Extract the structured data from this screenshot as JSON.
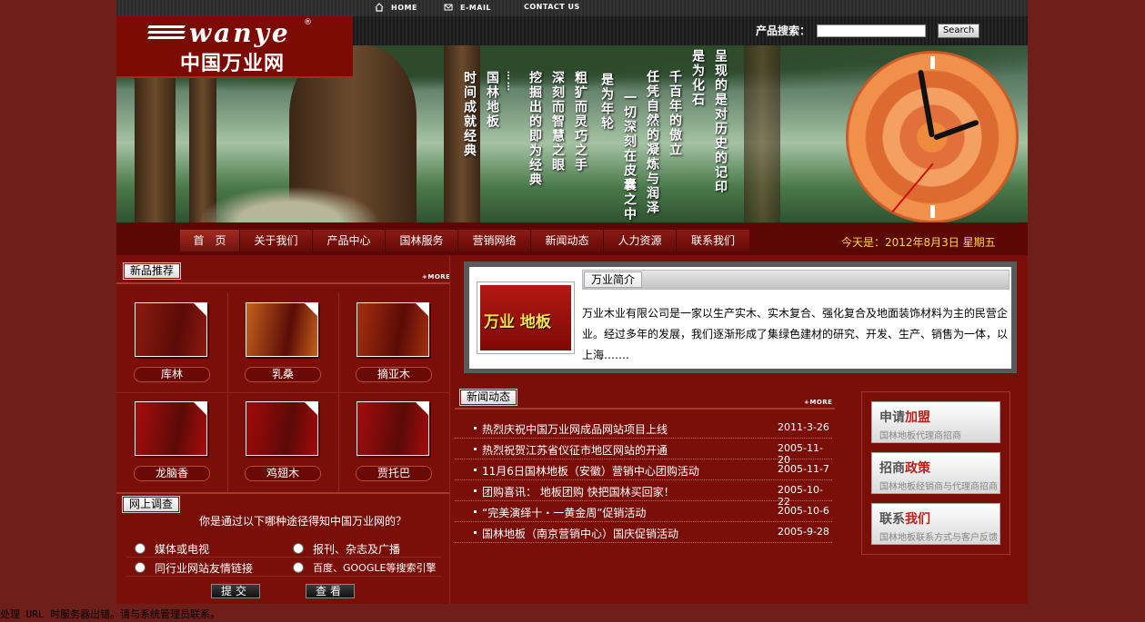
{
  "topbar": {
    "home": "HOME",
    "email": "E-MAIL",
    "contact": "CONTACT US"
  },
  "logo": {
    "en": "wanye",
    "reg": "®",
    "cn": "中国万业网"
  },
  "search": {
    "label": "产品搜索：",
    "value": "",
    "button": "Search"
  },
  "banner": {
    "columns": [
      "呈现的是对历史的记印",
      "是为化石",
      "千百年的傲立",
      "任凭自然的凝炼与润泽",
      "一切深刻在皮囊之中",
      "是为年轮",
      "粗犷而灵巧之手",
      "深刻而智慧之眼",
      "挖掘出的即为经典",
      "……",
      "国林地板",
      "时间成就经典"
    ]
  },
  "nav": {
    "items": [
      "首　页",
      "关于我们",
      "产品中心",
      "国林服务",
      "营销网络",
      "新闻动态",
      "人力资源",
      "联系我们"
    ],
    "date": "今天是：2012年8月3日  星期五"
  },
  "products": {
    "title": "新品推荐",
    "more": "+MORE",
    "items": [
      {
        "name": "库林",
        "color": "#8c1a10"
      },
      {
        "name": "乳桑",
        "color": "#c4621b"
      },
      {
        "name": "摘亚木",
        "color": "#a4300f"
      },
      {
        "name": "龙脑香",
        "color": "#a80d0d"
      },
      {
        "name": "鸡翅木",
        "color": "#a3090a"
      },
      {
        "name": "贾托巴",
        "color": "#a30c0e"
      }
    ]
  },
  "survey": {
    "title": "网上调查",
    "question": "你是通过以下哪种途径得知中国万业网的？",
    "options": [
      "媒体或电视",
      "报刊、杂志及广播",
      "同行业网站友情链接",
      "百度、GOOGLE等搜索引擎"
    ],
    "submit": "提交",
    "view": "查看"
  },
  "intro": {
    "title": "万业简介",
    "img_title": "万业 地板",
    "text": "万业木业有限公司是一家以生产实木、实木复合、强化复合及地面装饰材料为主的民营企业。经过多年的发展，我们逐渐形成了集绿色建材的研究、开发、生产、销售为一体，以上海……."
  },
  "news": {
    "title": "新闻动态",
    "more": "+MORE",
    "items": [
      {
        "title": "热烈庆祝中国万业网成品网站项目上线",
        "date": "2011-3-26"
      },
      {
        "title": "热烈祝贺江苏省仪征市地区网站的开通",
        "date": "2005-11-20"
      },
      {
        "title": "11月6日国林地板（安徽）营销中心团购活动",
        "date": "2005-11-7"
      },
      {
        "title": "团购喜讯：  地板团购  快把国林买回家！",
        "date": "2005-10-22"
      },
      {
        "title": "“完美演绎十・一黄金周”促销活动",
        "date": "2005-10-6"
      },
      {
        "title": "国林地板（南京营销中心）国庆促销活动",
        "date": "2005-9-28"
      }
    ]
  },
  "ads": [
    {
      "big1": "申请",
      "big2": "加盟",
      "small": "国林地板代理商招商"
    },
    {
      "big1": "招商",
      "big2": "政策",
      "small": "国林地板经销商与代理商招商"
    },
    {
      "big1": "联系",
      "big2": "我们",
      "small": "国林地板联系方式与客户反馈"
    }
  ],
  "error": "处理 URL 时服务器出错。请与系统管理员联系。"
}
